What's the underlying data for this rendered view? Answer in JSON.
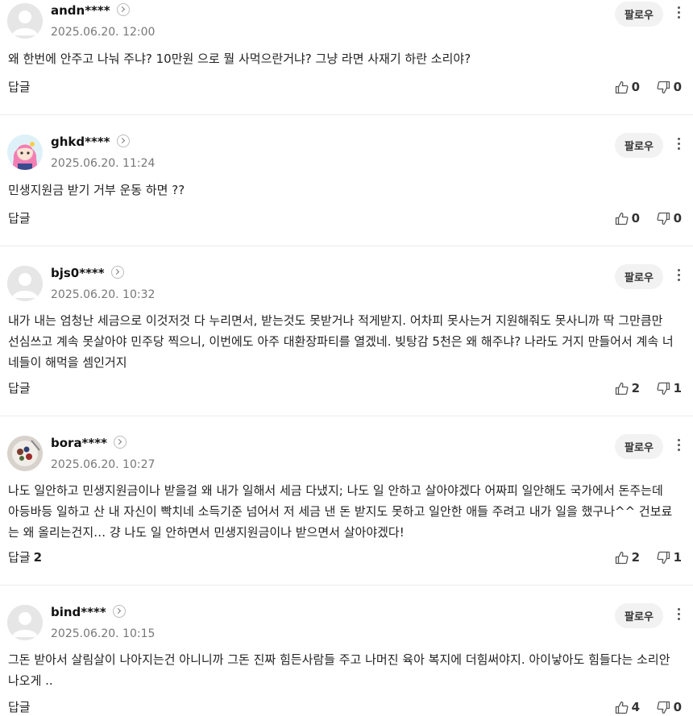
{
  "follow_label": "팔로우",
  "reply_label": "답글",
  "comments": [
    {
      "user": "andn****",
      "date": "2025.06.20. 12:00",
      "text": "왜 한번에 안주고 나눠 주냐? 10만원 으로 뭘 사먹으란거냐? 그냥 라면 사재기 하란 소리야?",
      "reply_count": "",
      "likes": "0",
      "dislikes": "0",
      "avatar": "default"
    },
    {
      "user": "ghkd****",
      "date": "2025.06.20. 11:24",
      "text": "민생지원금 받기 거부 운동 하면 ??",
      "reply_count": "",
      "likes": "0",
      "dislikes": "0",
      "avatar": "character"
    },
    {
      "user": "bjs0****",
      "date": "2025.06.20. 10:32",
      "text": "내가 내는 엄청난 세금으로 이것저것 다 누리면서, 받는것도 못받거나 적게받지. 어차피 못사는거 지원해줘도 못사니까 딱 그만큼만 선심쓰고 계속 못살아야 민주당 찍으니, 이번에도 아주 대환장파티를 열겠네. 빚탕감 5천은 왜 해주냐? 나라도 거지 만들어서 계속 너네들이 해먹을 셈인거지",
      "reply_count": "",
      "likes": "2",
      "dislikes": "1",
      "avatar": "default"
    },
    {
      "user": "bora****",
      "date": "2025.06.20. 10:27",
      "text": "나도 일안하고 민생지원금이나 받을걸 왜 내가 일해서 세금 다냈지; 나도 일 안하고 살아야겠다 어짜피 일안해도 국가에서 돈주는데 아등바등 일하고 산 내 자신이 빡치네 소득기준 넘어서 저 세금 낸 돈 받지도 못하고 일안한 애들 주려고 내가 일을 했구나^^ 건보료는 왜 올리는건지… 걍 나도 일 안하면서 민생지원금이나 받으면서 살아야겠다!",
      "reply_count": "2",
      "likes": "2",
      "dislikes": "1",
      "avatar": "photo"
    },
    {
      "user": "bind****",
      "date": "2025.06.20. 10:15",
      "text": "그돈 받아서 살림살이 나아지는건 아니니까 그돈 진짜 힘든사람들 주고 나머진 육아 복지에 더힘써야지. 아이낳아도 힘들다는 소리안나오게 ..",
      "reply_count": "",
      "likes": "4",
      "dislikes": "0",
      "avatar": "default"
    }
  ]
}
